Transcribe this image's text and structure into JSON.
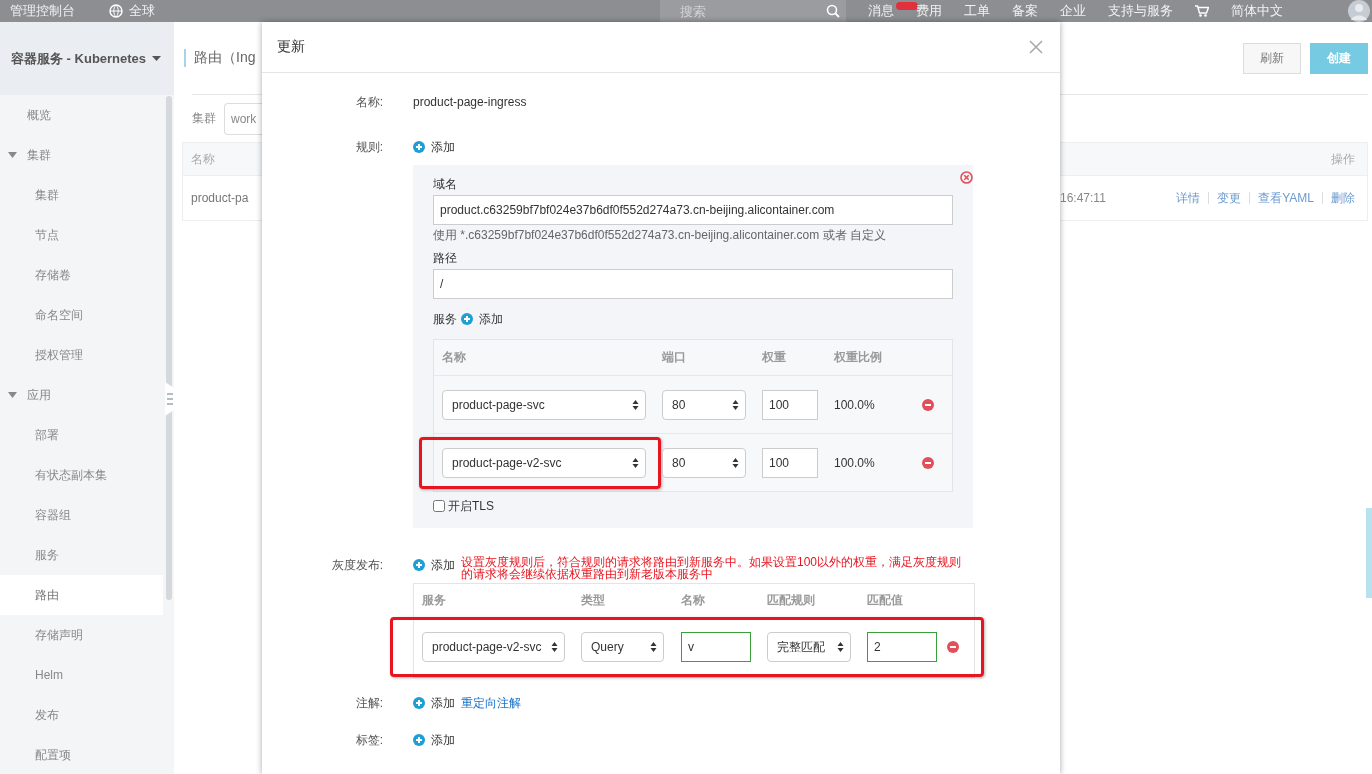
{
  "top_bar": {
    "items": [
      {
        "kind": "brand",
        "label": "管理控制台"
      },
      {
        "kind": "region",
        "label": "全球"
      },
      {
        "kind": "search",
        "placeholder": "搜索"
      },
      {
        "kind": "link",
        "label": "消息",
        "badge": true
      },
      {
        "kind": "link",
        "label": "费用",
        "badge": false
      },
      {
        "kind": "link",
        "label": "工单",
        "badge": false
      },
      {
        "kind": "link",
        "label": "备案",
        "badge": false
      },
      {
        "kind": "link",
        "label": "企业",
        "badge": false
      },
      {
        "kind": "link",
        "label": "支持与服务",
        "badge": false
      },
      {
        "kind": "cart"
      },
      {
        "kind": "link",
        "label": "简体中文",
        "badge": false
      },
      {
        "kind": "avatar"
      }
    ]
  },
  "sidebar": {
    "title": "容器服务 - Kubernetes",
    "items": [
      {
        "label": "概览",
        "selected": false
      },
      {
        "label": "集群",
        "selected": false,
        "expanded": true,
        "children": [
          {
            "label": "集群",
            "selected": false
          },
          {
            "label": "节点",
            "selected": false
          },
          {
            "label": "存储卷",
            "selected": false
          },
          {
            "label": "命名空间",
            "selected": false
          },
          {
            "label": "授权管理",
            "selected": false
          }
        ]
      },
      {
        "label": "应用",
        "selected": false,
        "expanded": true,
        "children": [
          {
            "label": "部署",
            "selected": false
          },
          {
            "label": "有状态副本集",
            "selected": false
          },
          {
            "label": "容器组",
            "selected": false
          },
          {
            "label": "服务",
            "selected": false
          },
          {
            "label": "路由",
            "selected": true
          },
          {
            "label": "存储声明",
            "selected": false
          },
          {
            "label": "Helm",
            "selected": false
          },
          {
            "label": "发布",
            "selected": false
          },
          {
            "label": "配置项",
            "selected": false
          }
        ]
      }
    ]
  },
  "page": {
    "title": "路由（Ing",
    "cluster_label": "集群",
    "cluster_value": "work",
    "buttons": [
      {
        "label": "刷新",
        "kind": "default"
      },
      {
        "label": "创建",
        "kind": "primary"
      }
    ],
    "table": {
      "columns": [
        "名称",
        "操作"
      ],
      "rows": [
        {
          "name": "product-pa",
          "time": "16:47:11",
          "actions": [
            "详情",
            "变更",
            "查看YAML",
            "删除"
          ]
        }
      ]
    }
  },
  "modal": {
    "title": "更新",
    "name_field": {
      "label": "名称:",
      "value": "product-page-ingress"
    },
    "rules": {
      "label": "规则:",
      "add": "添加",
      "items": [
        {
          "domain_label": "域名",
          "domain": "product.c63259bf7bf024e37b6df0f552d274a73.cn-beijing.alicontainer.com",
          "hint": "使用 *.c63259bf7bf024e37b6df0f552d274a73.cn-beijing.alicontainer.com 或者 自定义",
          "path_label": "路径",
          "path": "/",
          "services_label": "服务",
          "services_add": "添加",
          "columns": [
            "名称",
            "端口",
            "权重",
            "权重比例"
          ],
          "services": [
            {
              "name": "product-page-svc",
              "port": "80",
              "weight": "100",
              "ratio": "100.0%",
              "highlighted": false
            },
            {
              "name": "product-page-v2-svc",
              "port": "80",
              "weight": "100",
              "ratio": "100.0%",
              "highlighted": true
            }
          ],
          "tls_label": "开启TLS",
          "tls": false
        }
      ]
    },
    "canary": {
      "label": "灰度发布:",
      "add": "添加",
      "note": "设置灰度规则后，符合规则的请求将路由到新服务中。如果设置100以外的权重，满足灰度规则的请求将会继续依据权重路由到新老版本服务中",
      "columns": [
        "服务",
        "类型",
        "名称",
        "匹配规则",
        "匹配值"
      ],
      "rules": [
        {
          "service": "product-page-v2-svc",
          "type": "Query",
          "name": "v",
          "match": "完整匹配",
          "value": "2",
          "highlighted": true
        }
      ]
    },
    "annotations": {
      "label": "注解:",
      "add": "添加",
      "link": "重定向注解"
    },
    "labels": {
      "label": "标签:",
      "add": "添加"
    }
  }
}
